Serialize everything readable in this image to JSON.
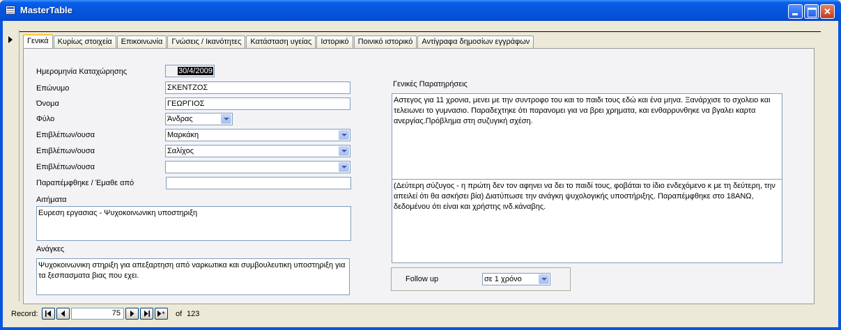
{
  "window": {
    "title": "MasterTable"
  },
  "tabs": [
    {
      "label": "Γενικά"
    },
    {
      "label": "Κυρίως στοιχεία"
    },
    {
      "label": "Επικοινωνία"
    },
    {
      "label": "Γνώσεις / Ικανότητες"
    },
    {
      "label": "Κατάσταση υγείας"
    },
    {
      "label": "Ιστορικό"
    },
    {
      "label": "Ποινικό ιστορικό"
    },
    {
      "label": "Αντίγραφα δημοσίων εγγράφων"
    }
  ],
  "form": {
    "registration_date_label": "Ημερομηνία Καταχώρησης",
    "registration_date": "30/4/2009",
    "surname_label": "Επώνυμο",
    "surname": "ΣΚΕΝΤΖΟΣ",
    "name_label": "Όνομα",
    "name": "ΓΕΩΡΓΙΟΣ",
    "gender_label": "Φύλο",
    "gender": "Άνδρας",
    "supervisor1_label": "Επιβλέπων/ουσα",
    "supervisor1": "Μαρκάκη",
    "supervisor2_label": "Επιβλέπων/ουσα",
    "supervisor2": "Σαλίχος",
    "supervisor3_label": "Επιβλέπων/ουσα",
    "supervisor3": "",
    "referral_label": "Παραπέμφθηκε / Έμαθε από",
    "referral": "",
    "requests_label": "Αιτήματα",
    "requests": "Ευρεση εργασιας - Ψυχοκοινωνικη υποστηριξη",
    "needs_label": "Ανάγκες",
    "needs": "Ψυχοκοινωνικη στηριξη για απεξαρτηση από ναρκωτικα και συμβουλευτικη υποστηριξη για τα ξεσπασματα βιας που εχει.",
    "remarks_label": "Γενικές Παρατηρήσεις",
    "remarks_1": "Αστεγος για 11 χρονια, μενει με την συντροφο του και το παιδι τους εδώ και ένα μηνα.  Ξανάρχισε το σχολειο και τελειωνει το γυμνασιο. Παραδεχτηκε ότι παρανομει για να βρει χρηματα, και ενθαρρυνθηκε να βγαλει καρτα ανεργίας.Πρόβλημα στη συζυγική σχέση.",
    "remarks_2": " (Δεύτερη σύζυγος - η πρώτη δεν τον αφηνει να δει το παιδί τους, φοβάται το ίδιο ενδεχόμενο κ με τη δεύτερη, την απειλεί ότι θα ασκήσει βία) Διατύπωσε την ανάγκη ψυχολογικής υποστήριξης. Παραπέμφθηκε στο 18ΑΝΩ, δεδομένου ότι είναι και χρήστης ινδ.κάναβης.",
    "followup_label": "Follow up",
    "followup": "σε 1 χρόνο"
  },
  "navigation": {
    "record_label": "Record:",
    "current": "75",
    "of_label": "of",
    "total": "123"
  },
  "icons": [
    "form-icon",
    "minimize-icon",
    "maximize-icon",
    "close-icon",
    "record-selector-arrow-icon",
    "first-record-icon",
    "prev-record-icon",
    "next-record-icon",
    "last-record-icon",
    "new-record-icon",
    "chevron-down-icon"
  ]
}
